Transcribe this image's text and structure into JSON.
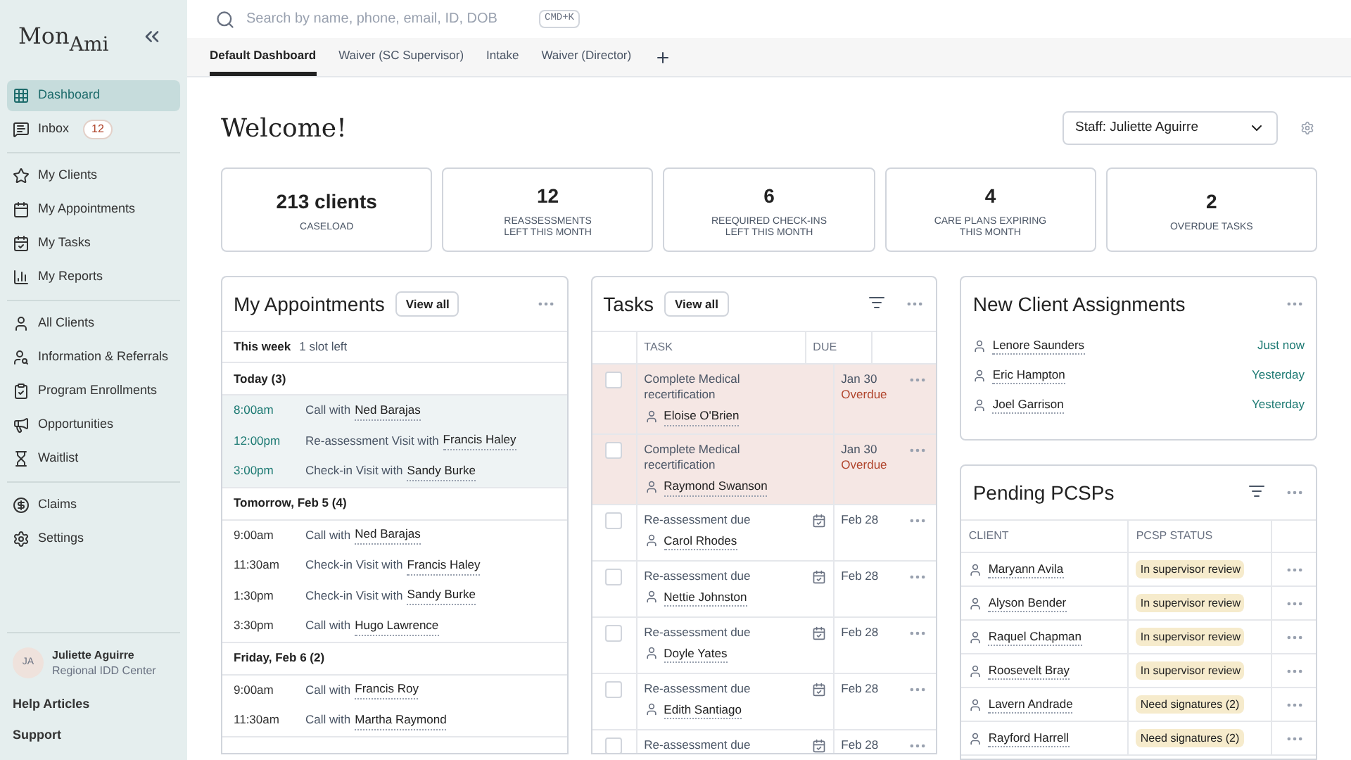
{
  "sidebar": {
    "logo": {
      "main": "Mon",
      "sub": "Ami"
    },
    "sections": [
      [
        {
          "label": "Dashboard",
          "selected": true
        },
        {
          "label": "Inbox",
          "selected": false,
          "badge": "12"
        }
      ],
      [
        {
          "label": "My Clients",
          "selected": false
        },
        {
          "label": "My Appointments",
          "selected": false
        },
        {
          "label": "My Tasks",
          "selected": false
        },
        {
          "label": "My Reports",
          "selected": false
        }
      ],
      [
        {
          "label": "All Clients",
          "selected": false
        },
        {
          "label": "Information & Referrals",
          "selected": false
        },
        {
          "label": "Program Enrollments",
          "selected": false
        },
        {
          "label": "Opportunities",
          "selected": false
        },
        {
          "label": "Waitlist",
          "selected": false
        }
      ],
      [
        {
          "label": "Claims",
          "selected": false
        },
        {
          "label": "Settings",
          "selected": false
        }
      ]
    ],
    "user": {
      "initials": "JA",
      "name": "Juliette Aguirre",
      "org": "Regional IDD Center"
    },
    "links": [
      "Help Articles",
      "Support"
    ]
  },
  "search": {
    "placeholder": "Search by name, phone, email, ID, DOB",
    "shortcut": "CMD+K"
  },
  "tabs": [
    {
      "label": "Default Dashboard",
      "selected": true
    },
    {
      "label": "Waiver (SC Supervisor)",
      "selected": false
    },
    {
      "label": "Intake",
      "selected": false
    },
    {
      "label": "Waiver (Director)",
      "selected": false
    }
  ],
  "heading": "Welcome!",
  "staff_select": {
    "value": "Staff: Juliette Aguirre"
  },
  "stats": [
    {
      "value": "213 clients",
      "label": "CASELOAD"
    },
    {
      "value": "12",
      "label": "REASSESSMENTS\nLEFT THIS MONTH"
    },
    {
      "value": "6",
      "label": "REEQUIRED CHECK-INS\nLEFT THIS MONTH"
    },
    {
      "value": "4",
      "label": "CARE PLANS EXPIRING\nTHIS MONTH"
    },
    {
      "value": "2",
      "label": "OVERDUE TASKS"
    }
  ],
  "appointments": {
    "title": "My Appointments",
    "view_all": "View all",
    "week": {
      "label": "This week",
      "note": "1 slot left"
    },
    "groups": [
      {
        "header": "Today (3)",
        "highlighted": true,
        "items": [
          {
            "time": "8:00am",
            "text": "Call with",
            "client": "Ned Barajas"
          },
          {
            "time": "12:00pm",
            "text": "Re-assessment Visit with",
            "client": "Francis Haley"
          },
          {
            "time": "3:00pm",
            "text": "Check-in Visit with",
            "client": "Sandy Burke"
          }
        ]
      },
      {
        "header": "Tomorrow, Feb 5 (4)",
        "highlighted": false,
        "items": [
          {
            "time": "9:00am",
            "text": "Call with",
            "client": "Ned Barajas"
          },
          {
            "time": "11:30am",
            "text": "Check-in Visit with",
            "client": "Francis Haley"
          },
          {
            "time": "1:30pm",
            "text": "Check-in Visit with",
            "client": "Sandy Burke"
          },
          {
            "time": "3:30pm",
            "text": "Call with",
            "client": "Hugo Lawrence"
          }
        ]
      },
      {
        "header": "Friday, Feb 6 (2)",
        "highlighted": false,
        "items": [
          {
            "time": "9:00am",
            "text": "Call with",
            "client": "Francis Roy"
          },
          {
            "time": "11:30am",
            "text": "Call with",
            "client": "Martha Raymond"
          }
        ]
      }
    ]
  },
  "tasks": {
    "title": "Tasks",
    "view_all": "View all",
    "columns": [
      "TASK",
      "DUE"
    ],
    "rows": [
      {
        "task": "Complete Medical recertification",
        "client": "Eloise O'Brien",
        "due": "Jan 30",
        "status": "Overdue",
        "overdue": true,
        "checked": false
      },
      {
        "task": "Complete Medical recertification",
        "client": "Raymond Swanson",
        "due": "Jan 30",
        "status": "Overdue",
        "overdue": true,
        "checked": false
      },
      {
        "task": "Re-assessment due",
        "client": "Carol Rhodes",
        "due": "Feb 28",
        "overdue": false,
        "checked": false
      },
      {
        "task": "Re-assessment due",
        "client": "Nettie Johnston",
        "due": "Feb 28",
        "overdue": false,
        "checked": false
      },
      {
        "task": "Re-assessment due",
        "client": "Doyle Yates",
        "due": "Feb 28",
        "overdue": false,
        "checked": false
      },
      {
        "task": "Re-assessment due",
        "client": "Edith Santiago",
        "due": "Feb 28",
        "overdue": false,
        "checked": false
      },
      {
        "task": "Re-assessment due",
        "due": "Feb 28",
        "overdue": false,
        "checked": false
      }
    ]
  },
  "assignments": {
    "title": "New Client Assignments",
    "items": [
      {
        "client": "Lenore Saunders",
        "when": "Just now"
      },
      {
        "client": "Eric Hampton",
        "when": "Yesterday"
      },
      {
        "client": "Joel Garrison",
        "when": "Yesterday"
      }
    ]
  },
  "pcsps": {
    "title": "Pending PCSPs",
    "columns": [
      "CLIENT",
      "PCSP STATUS"
    ],
    "rows": [
      {
        "client": "Maryann Avila",
        "status": "In supervisor review"
      },
      {
        "client": "Alyson Bender",
        "status": "In supervisor review"
      },
      {
        "client": "Raquel Chapman",
        "status": "In supervisor review"
      },
      {
        "client": "Roosevelt Bray",
        "status": "In supervisor review"
      },
      {
        "client": "Lavern Andrade",
        "status": "Need signatures (2)"
      },
      {
        "client": "Rayford Harrell",
        "status": "Need signatures (2)"
      }
    ]
  }
}
